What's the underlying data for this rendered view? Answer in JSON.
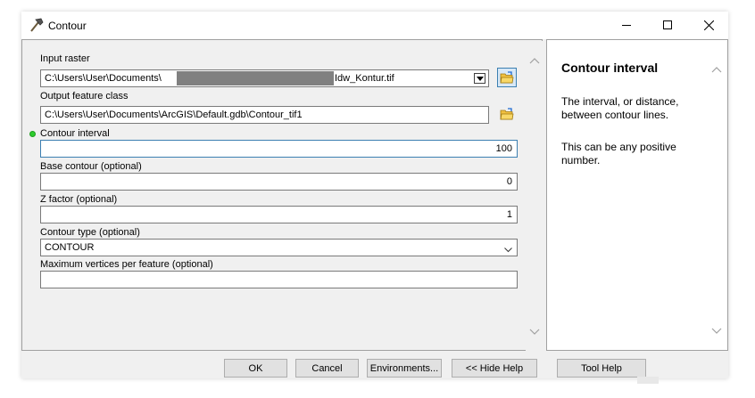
{
  "window": {
    "title": "Contour",
    "icon": "hammer-icon"
  },
  "form": {
    "input_raster": {
      "label": "Input raster",
      "value_prefix": "C:\\Users\\User\\Documents\\",
      "value_suffix": "Idw_Kontur.tif"
    },
    "output_feature_class": {
      "label": "Output feature class",
      "value": "C:\\Users\\User\\Documents\\ArcGIS\\Default.gdb\\Contour_tif1"
    },
    "contour_interval": {
      "label": "Contour interval",
      "value": "100",
      "required": true
    },
    "base_contour": {
      "label": "Base contour (optional)",
      "value": "0"
    },
    "z_factor": {
      "label": "Z factor (optional)",
      "value": "1"
    },
    "contour_type": {
      "label": "Contour type (optional)",
      "value": "CONTOUR"
    },
    "max_vertices": {
      "label": "Maximum vertices per feature (optional)",
      "value": ""
    }
  },
  "help": {
    "title": "Contour interval",
    "paragraphs": [
      "The interval, or distance, between contour lines.",
      "This can be any positive number."
    ]
  },
  "buttons": {
    "ok": "OK",
    "cancel": "Cancel",
    "environments": "Environments...",
    "hide_help": "<< Hide Help",
    "tool_help": "Tool Help"
  },
  "colors": {
    "accent": "#3c7fb1",
    "required_dot": "#2ecc2e",
    "redaction": "#808080"
  }
}
